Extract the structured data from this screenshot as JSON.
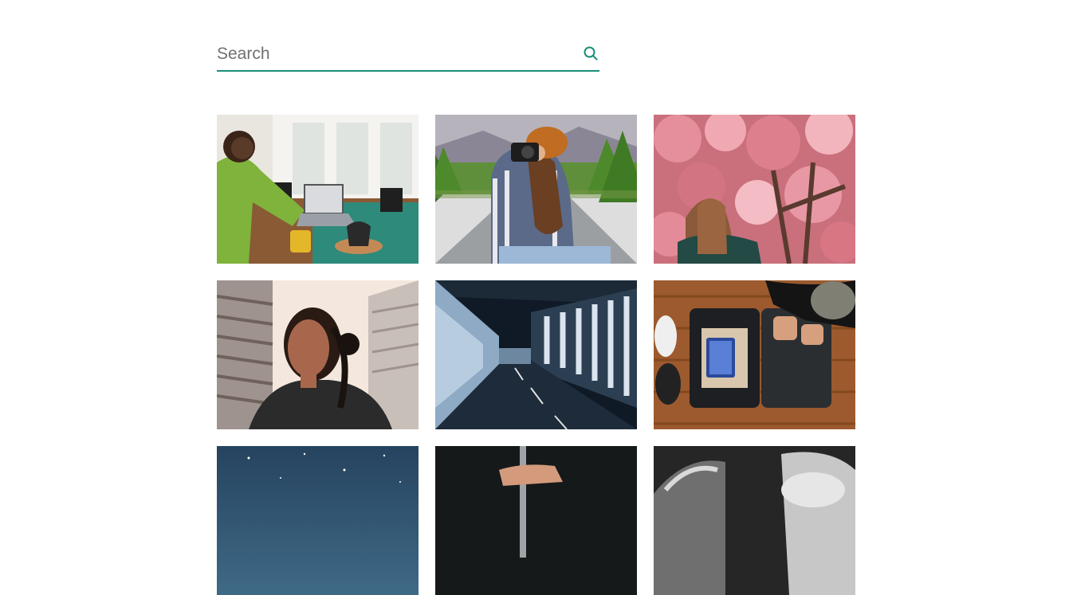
{
  "search": {
    "placeholder": "Search",
    "value": "",
    "icon": "search-icon"
  },
  "theme": {
    "accent": "#1a8f76"
  },
  "gallery": {
    "photos": [
      {
        "subject": "woman-with-laptop-at-table"
      },
      {
        "subject": "photographer-on-road"
      },
      {
        "subject": "woman-under-cherry-blossom"
      },
      {
        "subject": "woman-portrait-city"
      },
      {
        "subject": "futuristic-tunnel"
      },
      {
        "subject": "packing-suitcase"
      },
      {
        "subject": "night-sky"
      },
      {
        "subject": "hand-holding-pen"
      },
      {
        "subject": "car-interior"
      }
    ]
  }
}
